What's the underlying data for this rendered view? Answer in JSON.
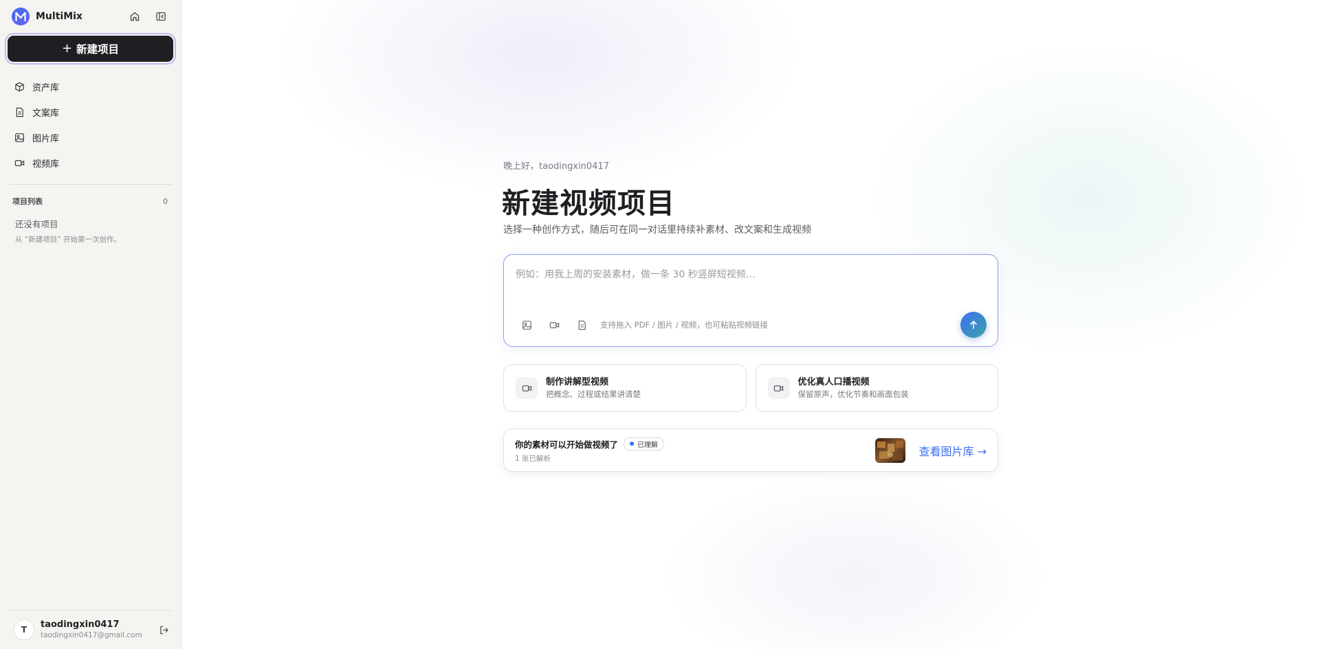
{
  "sidebar": {
    "brand": {
      "logo_letter": "M",
      "name": "MultiMix"
    },
    "header_icons": [
      "home-icon",
      "sidebar-toggle-icon"
    ],
    "new_project": {
      "plus": "+",
      "label": "新建项目"
    },
    "nav": [
      {
        "label": "资产库",
        "icon": "cube-icon"
      },
      {
        "label": "文案库",
        "icon": "document-icon"
      },
      {
        "label": "图片库",
        "icon": "image-icon"
      },
      {
        "label": "视频库",
        "icon": "video-icon"
      }
    ],
    "projects": {
      "heading": "项目列表",
      "count": "0",
      "empty_title": "还没有项目",
      "empty_sub": "从 “新建项目” 开始第一次创作。"
    },
    "user": {
      "initial": "T",
      "name": "taodingxin0417",
      "email": "taodingxin0417@gmail.com",
      "logout_icon": "logout-icon"
    }
  },
  "main": {
    "greeting": "晚上好，taodingxin0417",
    "title": "新建视频项目",
    "subtitle": "选择一种创作方式，随后可在同一对话里持续补素材、改文案和生成视频",
    "composer": {
      "placeholder": "例如：用我上周的安装素材，做一条 30 秒竖屏短视频…",
      "value": "",
      "tools": [
        "image-icon",
        "video-icon",
        "document-icon"
      ],
      "hint": "支持拖入 PDF / 图片 / 视频，也可粘贴视频链接",
      "send_icon": "arrow-up-icon"
    },
    "cards": [
      {
        "title": "制作讲解型视频",
        "sub": "把概念、过程或结果讲清楚",
        "icon": "video-icon"
      },
      {
        "title": "优化真人口播视频",
        "sub": "保留原声，优化节奏和画面包装",
        "icon": "video-icon"
      }
    ],
    "assets": {
      "title": "你的素材可以开始做视频了",
      "badge": "已理解",
      "sub": "1 张已解析",
      "link": "查看图片库 →"
    }
  },
  "colors": {
    "accent": "#3b6ff0",
    "sidebar_bg": "#f5f4f1",
    "new_button_bg": "#1f1f23",
    "new_button_ring": "#c9b6f3",
    "composer_border": "#8d9de6",
    "send_gradient_end": "#3ba3a8"
  }
}
